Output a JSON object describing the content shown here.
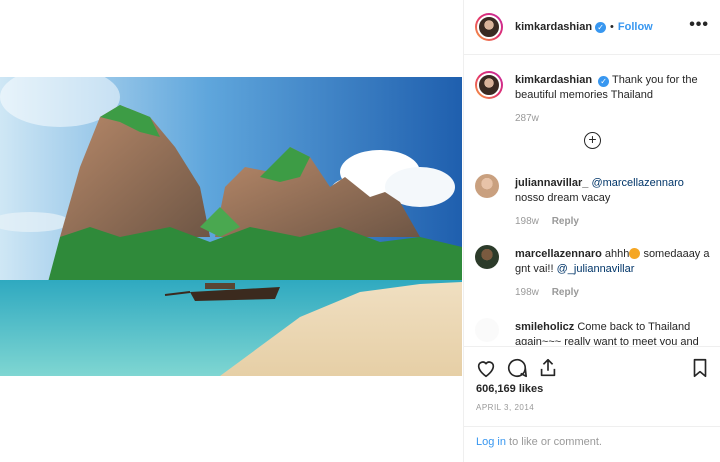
{
  "post": {
    "username": "kimkardashian",
    "verified_icon": "verified-badge-icon",
    "separator": "•",
    "follow_label": "Follow",
    "more_label": "•••"
  },
  "caption": {
    "username": "kimkardashian",
    "text": "Thank you for the beautiful memories Thailand",
    "time": "287w"
  },
  "comments": [
    {
      "username": "juliannavillar_",
      "mention": "@marcellazennaro",
      "text": "nosso dream vacay",
      "time": "198w",
      "reply_label": "Reply"
    },
    {
      "username": "marcellazennaro",
      "text_before": "ahhh",
      "emoji": "heart-eyes-emoji",
      "text_after": "somedaaay a gnt vai!!",
      "mention": "@_juliannavillar",
      "time": "198w",
      "reply_label": "Reply"
    },
    {
      "username": "smileholicz",
      "text": "Come back to Thailand again~~~ really want to meet you and"
    }
  ],
  "actions": {
    "like_icon": "heart-icon",
    "comment_icon": "comment-icon",
    "share_icon": "share-icon",
    "save_icon": "bookmark-icon",
    "likes": "606,169 likes",
    "date": "APRIL 3, 2014"
  },
  "login": {
    "link": "Log in",
    "rest": " to like or comment."
  },
  "colors": {
    "accent": "#3897f0",
    "muted": "#999999",
    "text": "#262626"
  }
}
